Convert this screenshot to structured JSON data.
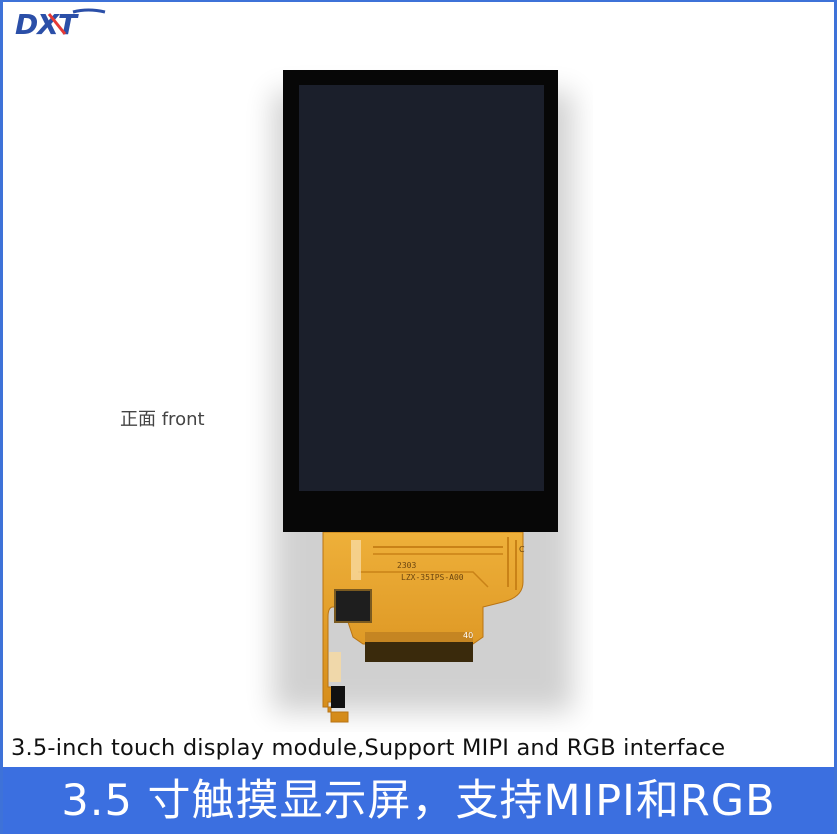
{
  "brand": {
    "logo_text": "DXT",
    "logo_color": "#2b4fa8",
    "logo_accent": "#e53935"
  },
  "product": {
    "front_label": "正面 front",
    "fpc_code": "2303",
    "fpc_model": "LZX-35IPS-A00",
    "fpc_pin_label": "40",
    "fpc_corner_label": "C",
    "screen_color": "#1b1f2b",
    "bezel_color": "#070707",
    "fpc_color": "#e6a12a"
  },
  "captions": {
    "english": "3.5-inch touch display module,Support MIPI and RGB interface",
    "chinese": "3.5 寸触摸显示屏，支持MIPI和RGB"
  },
  "theme": {
    "frame_color": "#3e72d8",
    "banner_color": "#3b6fe0"
  }
}
